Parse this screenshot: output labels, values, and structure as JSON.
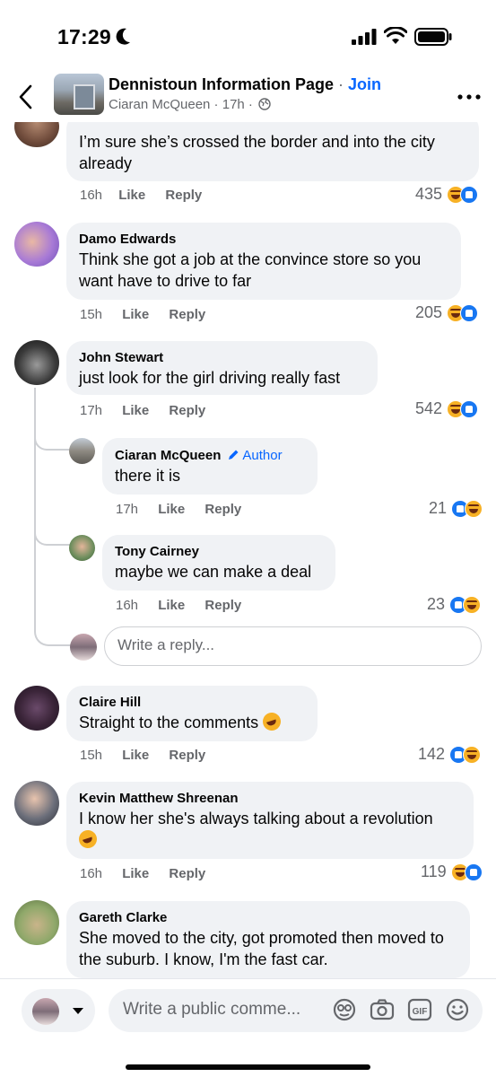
{
  "status": {
    "time": "17:29"
  },
  "header": {
    "group_name": "Dennistoun Information Page",
    "separator": " · ",
    "join_label": "Join",
    "poster": "Ciaran McQueen",
    "post_time": "17h",
    "sub_sep": " · "
  },
  "comments": [
    {
      "author": "",
      "text": "I’m sure she’s crossed the border and into the city already",
      "time": "16h",
      "like": "Like",
      "reply": "Reply",
      "reactions": "435",
      "icons": [
        "haha-icon",
        "like-icon"
      ]
    },
    {
      "author": "Damo Edwards",
      "text": "Think she got a job at the convince store so you want have to drive to far",
      "time": "15h",
      "like": "Like",
      "reply": "Reply",
      "reactions": "205",
      "icons": [
        "haha-icon",
        "like-icon"
      ]
    },
    {
      "author": "John Stewart",
      "text": "just look for the girl driving really fast",
      "time": "17h",
      "like": "Like",
      "reply": "Reply",
      "reactions": "542",
      "icons": [
        "haha-icon",
        "like-icon"
      ]
    },
    {
      "author": "Claire Hill",
      "text": "Straight to the comments",
      "time": "15h",
      "like": "Like",
      "reply": "Reply",
      "reactions": "142",
      "icons": [
        "like-icon",
        "haha-icon"
      ]
    },
    {
      "author": "Kevin Matthew Shreenan",
      "text": "I know her she's always talking about a revolution",
      "time": "16h",
      "like": "Like",
      "reply": "Reply",
      "reactions": "119",
      "icons": [
        "haha-icon",
        "like-icon"
      ]
    },
    {
      "author": "Gareth Clarke",
      "text": "She moved to the city, got promoted then moved to the suburb. I know, I'm the fast car."
    }
  ],
  "replies": [
    {
      "author": "Ciaran McQueen",
      "badge": "Author",
      "text": "there it is",
      "time": "17h",
      "like": "Like",
      "reply": "Reply",
      "reactions": "21",
      "icons": [
        "like-icon",
        "haha-icon"
      ]
    },
    {
      "author": "Tony Cairney",
      "text": "maybe we can make a deal",
      "time": "16h",
      "like": "Like",
      "reply": "Reply",
      "reactions": "23",
      "icons": [
        "like-icon",
        "haha-icon"
      ]
    }
  ],
  "reply_box": {
    "placeholder": "Write a reply..."
  },
  "composer": {
    "placeholder": "Write a public comme...",
    "gif_label": "GIF"
  },
  "colors": {
    "accent": "#0866ff",
    "bubble": "#f0f2f5",
    "muted": "#65676b"
  }
}
